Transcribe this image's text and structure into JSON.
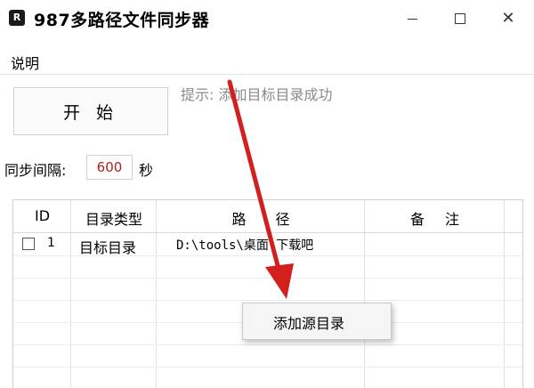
{
  "window": {
    "title": "987多路径文件同步器",
    "icon_text": "R",
    "controls": {
      "minimize_icon": "minimize-icon",
      "maximize_icon": "maximize-icon",
      "close_icon": "close-icon"
    }
  },
  "menu": {
    "items": [
      {
        "label": "说明"
      }
    ]
  },
  "start_button": {
    "label": "开 始"
  },
  "hint": "提示: 添加目标目录成功",
  "interval": {
    "label": "同步间隔:",
    "value": "600",
    "unit": "秒"
  },
  "table": {
    "headers": [
      "ID",
      "目录类型",
      "路 径",
      "备 注"
    ],
    "rows": [
      {
        "checked": false,
        "id": "1",
        "type": "目标目录",
        "path": "D:\\tools\\桌面\\下载吧",
        "note": ""
      }
    ]
  },
  "context_menu": {
    "items": [
      {
        "label": "添加源目录"
      }
    ]
  },
  "colors": {
    "interval_value": "#b02121",
    "hint": "#8a8a8a",
    "arrow": "#d41f1f"
  }
}
